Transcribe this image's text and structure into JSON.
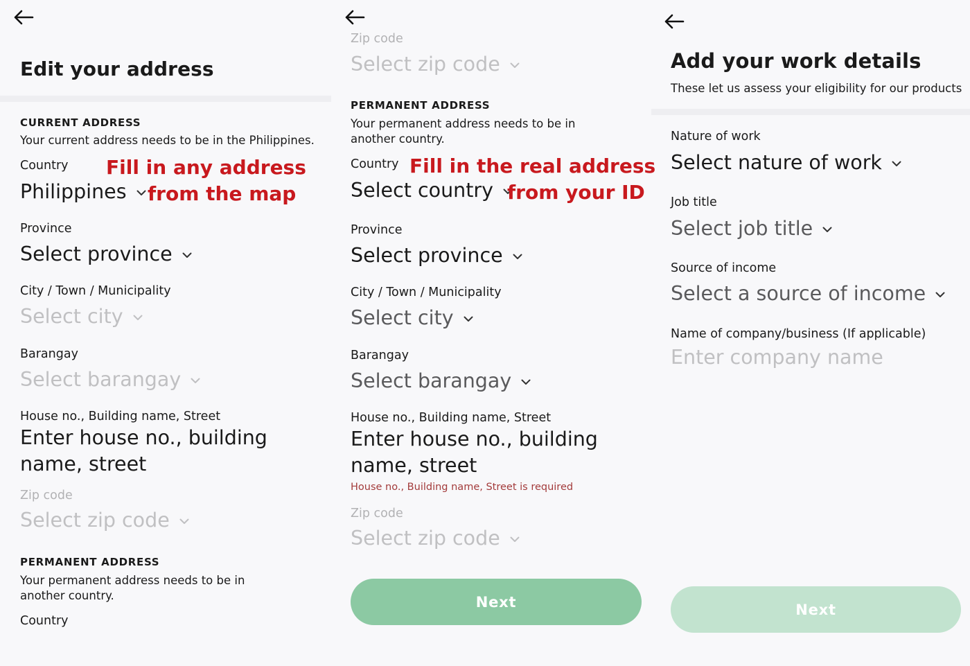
{
  "screen1": {
    "title": "Edit your address",
    "current_section": "CURRENT ADDRESS",
    "current_helper": "Your current address needs to be in the Philippines.",
    "country_label": "Country",
    "country_value": "Philippines",
    "annotation_line1": "Fill in any address",
    "annotation_line2": "from the map",
    "province_label": "Province",
    "province_value": "Select province",
    "city_label": "City / Town / Municipality",
    "city_value": "Select city",
    "barangay_label": "Barangay",
    "barangay_value": "Select barangay",
    "house_label": "House no., Building name, Street",
    "house_placeholder": "Enter house no., building name, street",
    "zip_label": "Zip code",
    "zip_value": "Select zip code",
    "permanent_section": "PERMANENT ADDRESS",
    "permanent_helper": "Your permanent address needs to be in another country.",
    "perm_country_label": "Country"
  },
  "screen2": {
    "zip_label_top": "Zip code",
    "zip_value_top": "Select zip code",
    "permanent_section": "PERMANENT ADDRESS",
    "permanent_helper": "Your permanent address needs to be in another country.",
    "country_label": "Country",
    "country_value": "Select country",
    "annotation_line1": "Fill in the real address",
    "annotation_line2": "from your ID",
    "province_label": "Province",
    "province_value": "Select province",
    "city_label": "City / Town / Municipality",
    "city_value": "Select city",
    "barangay_label": "Barangay",
    "barangay_value": "Select barangay",
    "house_label": "House no., Building name, Street",
    "house_placeholder": "Enter house no., building name, street",
    "house_error": "House no., Building name, Street is required",
    "zip_label": "Zip code",
    "zip_value": "Select zip code",
    "next_label": "Next"
  },
  "screen3": {
    "title": "Add your work details",
    "subtitle": "These let us assess your eligibility for our products",
    "nature_label": "Nature of work",
    "nature_value": "Select nature of work",
    "job_label": "Job title",
    "job_value": "Select job title",
    "income_label": "Source of income",
    "income_value": "Select a source of income",
    "company_label": "Name of company/business (If applicable)",
    "company_placeholder": "Enter company name",
    "next_label": "Next"
  },
  "icons": {
    "back": "arrow-left-icon",
    "dropdown": "chevron-down-icon"
  },
  "colors": {
    "annotation": "#c8191e",
    "button_green": "#8cc9a3",
    "button_disabled": "#c2e3cf",
    "error": "#a33b3b",
    "placeholder": "#c0c0c2"
  }
}
